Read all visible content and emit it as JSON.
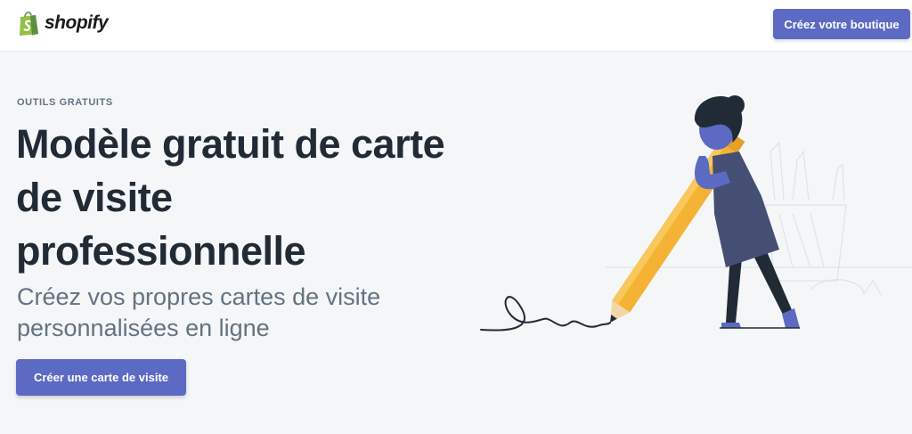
{
  "header": {
    "logo_text": "shopify",
    "cta_label": "Créez votre boutique"
  },
  "hero": {
    "eyebrow": "OUTILS GRATUITS",
    "title_lines": [
      "Modèle gratuit de carte",
      "de visite",
      "professionnelle"
    ],
    "subtitle_lines": [
      "Créez vos propres cartes de visite",
      "personnalisées en ligne"
    ],
    "cta_label": "Créer une carte de visite"
  },
  "colors": {
    "accent": "#5c6ac4",
    "heading": "#212b36",
    "muted": "#637381",
    "background": "#f4f6f8",
    "brand_green": "#95bf47"
  },
  "icons": [
    "shopify-bag-icon",
    "pencil-illustration"
  ]
}
